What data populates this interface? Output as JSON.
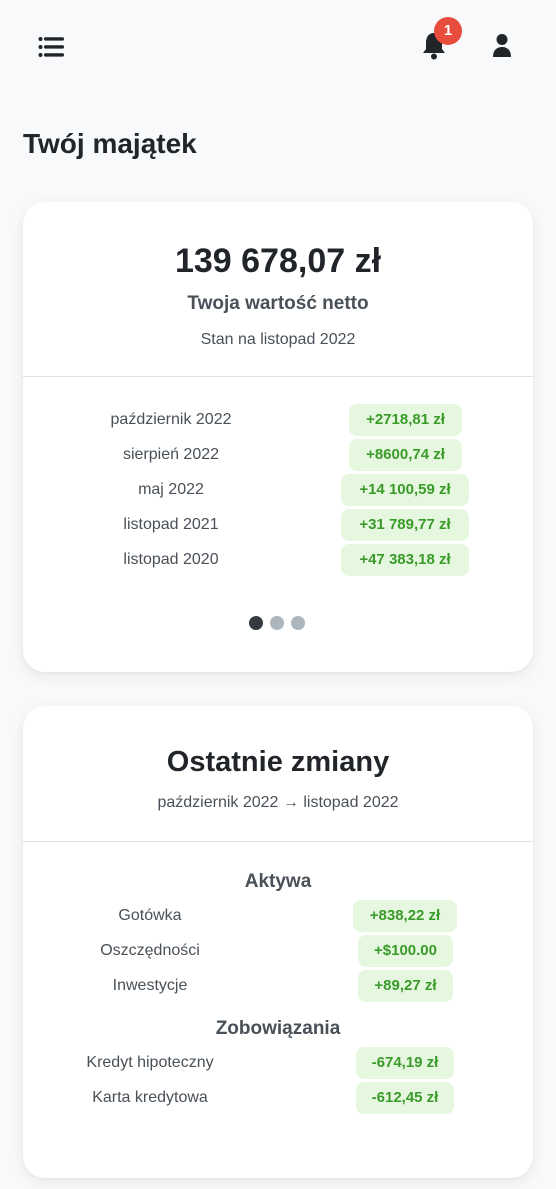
{
  "header": {
    "notification_count": "1"
  },
  "page": {
    "title": "Twój majątek"
  },
  "net_worth": {
    "value": "139 678,07 zł",
    "label": "Twoja wartość netto",
    "as_of": "Stan na listopad 2022",
    "history": [
      {
        "period": "październik 2022",
        "change": "+2718,81 zł"
      },
      {
        "period": "sierpień 2022",
        "change": "+8600,74 zł"
      },
      {
        "period": "maj 2022",
        "change": "+14 100,59 zł"
      },
      {
        "period": "listopad 2021",
        "change": "+31 789,77 zł"
      },
      {
        "period": "listopad 2020",
        "change": "+47 383,18 zł"
      }
    ],
    "carousel": {
      "pages": 3,
      "active_index": 0
    }
  },
  "recent_changes": {
    "title": "Ostatnie zmiany",
    "range": "październik 2022 → listopad 2022",
    "assets_heading": "Aktywa",
    "assets": [
      {
        "name": "Gotówka",
        "change": "+838,22 zł"
      },
      {
        "name": "Oszczędności",
        "change": "+$100.00"
      },
      {
        "name": "Inwestycje",
        "change": "+89,27 zł"
      }
    ],
    "liabilities_heading": "Zobowiązania",
    "liabilities": [
      {
        "name": "Kredyt hipoteczny",
        "change": "-674,19 zł"
      },
      {
        "name": "Karta kredytowa",
        "change": "-612,45 zł"
      }
    ]
  },
  "colors": {
    "positive_bg": "#e6f7df",
    "positive_text": "#3a9b2a",
    "badge": "#e74c3c",
    "dot_active": "#343a40",
    "dot_inactive": "#adb5bd"
  }
}
